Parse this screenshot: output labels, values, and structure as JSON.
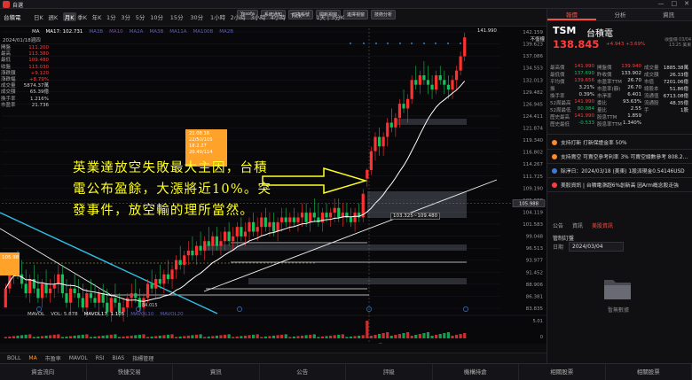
{
  "window": {
    "title": "自選",
    "controls": [
      "—",
      "□",
      "✕"
    ]
  },
  "toolbar": {
    "symbol": "台積電",
    "timeframes": [
      "日K",
      "週K",
      "月K",
      "季K",
      "年K",
      "1分",
      "3分",
      "5分",
      "10分",
      "15分",
      "30分",
      "1小時",
      "2小時",
      "3小時",
      "4小時",
      "Tick",
      "1天 | 3分K"
    ],
    "active_index": 2,
    "buttons": [
      "Yesofa",
      "系統通知",
      "切換帳號",
      "開新視窗",
      "進擇視窗",
      "技術分析"
    ]
  },
  "chart": {
    "stock_code": "2024/01/18",
    "ma_legend": [
      {
        "label": "MA",
        "color": "#dddddd"
      },
      {
        "label": "MA17: 102.731",
        "color": "#ffffff"
      },
      {
        "label": "MA3B",
        "color": "#5e5eb8"
      },
      {
        "label": "MA10",
        "color": "#7a4ea8"
      },
      {
        "label": "MA2A",
        "color": "#5e5eb8"
      },
      {
        "label": "MA3B",
        "color": "#5e5eb8"
      },
      {
        "label": "MA11A",
        "color": "#5e5eb8"
      },
      {
        "label": "MA100B",
        "color": "#5e5eb8"
      },
      {
        "label": "MA2B",
        "color": "#5e5eb8"
      }
    ],
    "date": "2024/01/18週四",
    "no_restore": "不復權",
    "info": [
      {
        "label": "開盤",
        "value": "111.200",
        "color": "#ff3b3b"
      },
      {
        "label": "最高",
        "value": "113.380",
        "color": "#ff3b3b"
      },
      {
        "label": "最低",
        "value": "109.480",
        "color": "#ff3b3b"
      },
      {
        "label": "收盤",
        "value": "113.030",
        "color": "#ff3b3b"
      },
      {
        "label": "漲跌額",
        "value": "+9.120",
        "color": "#ff3b3b"
      },
      {
        "label": "漲跌幅",
        "value": "+8.79%",
        "color": "#ff3b3b"
      },
      {
        "label": "成交量",
        "value": "5874.37萬",
        "color": "#cccccc"
      },
      {
        "label": "成交額",
        "value": "65.39億",
        "color": "#cccccc"
      },
      {
        "label": "換手率",
        "value": "1.216%",
        "color": "#cccccc"
      },
      {
        "label": "市盈率",
        "value": "21.736",
        "color": "#cccccc"
      }
    ],
    "annotation": "英業達放空失敗最大主因，台積電公布盈餘，大漲將近10%。突發事件，放空輸的理所當然。",
    "tooltip": [
      "21.08.16",
      "22/50/105",
      "18.2.27",
      "20.49/114"
    ],
    "range_label": "103.325~109.480",
    "left_tag": "105.98",
    "low_label": "84.015",
    "price_axis": [
      "142.159",
      "139.623",
      "137.086",
      "134.553",
      "132.013",
      "129.482",
      "126.945",
      "124.411",
      "121.874",
      "119.340",
      "116.802",
      "114.267",
      "111.725",
      "109.190",
      "105.988",
      "104.119",
      "101.583",
      "99.048",
      "96.513",
      "93.977",
      "91.452",
      "88.906",
      "86.381",
      "83.835"
    ],
    "price_current": "105.988",
    "high_mark": "141.990",
    "x_axis": [
      "2023/08",
      "9",
      "10",
      "11",
      "12",
      "2024/01/18週四",
      "2",
      "3"
    ],
    "vol_legend": [
      {
        "label": "MAVOL",
        "color": "#cccccc"
      },
      {
        "label": "VOL: 5.878",
        "color": "#cccccc"
      },
      {
        "label": "MAVOL17: 1.105",
        "color": "#ffffff"
      },
      {
        "label": "MAVOL10",
        "color": "#5e5eb8"
      },
      {
        "label": "MAVOL20",
        "color": "#5e5eb8"
      }
    ],
    "vol_axis": [
      "5.01",
      "0"
    ],
    "candles": [
      [
        84,
        89,
        84,
        88
      ],
      [
        88,
        92,
        87,
        91
      ],
      [
        91,
        95,
        89,
        93
      ],
      [
        93,
        96,
        90,
        91
      ],
      [
        91,
        94,
        88,
        89
      ],
      [
        89,
        92,
        86,
        87
      ],
      [
        87,
        91,
        85,
        90
      ],
      [
        90,
        93,
        87,
        88
      ],
      [
        88,
        91,
        85,
        86
      ],
      [
        86,
        90,
        84,
        89
      ],
      [
        89,
        92,
        86,
        87
      ],
      [
        87,
        90,
        85,
        88
      ],
      [
        88,
        91,
        86,
        89
      ],
      [
        89,
        93,
        87,
        91
      ],
      [
        91,
        93,
        86,
        87
      ],
      [
        87,
        90,
        84,
        85
      ],
      [
        85,
        89,
        83,
        88
      ],
      [
        88,
        91,
        86,
        87
      ],
      [
        87,
        90,
        84,
        86
      ],
      [
        86,
        89,
        83,
        84
      ],
      [
        84,
        88,
        82,
        87
      ],
      [
        87,
        90,
        85,
        86
      ],
      [
        86,
        89,
        84,
        85
      ],
      [
        85,
        88,
        83,
        87
      ],
      [
        87,
        89,
        84,
        85
      ],
      [
        85,
        88,
        82,
        83
      ],
      [
        83,
        87,
        81,
        86
      ],
      [
        86,
        89,
        84,
        85
      ],
      [
        85,
        87,
        82,
        83
      ],
      [
        83,
        86,
        81,
        84
      ],
      [
        84,
        87,
        82,
        86
      ],
      [
        86,
        89,
        84,
        87
      ],
      [
        87,
        90,
        85,
        86
      ],
      [
        86,
        88,
        83,
        84
      ],
      [
        84,
        87,
        82,
        86
      ],
      [
        86,
        90,
        85,
        89
      ],
      [
        89,
        92,
        87,
        88
      ],
      [
        88,
        91,
        86,
        90
      ],
      [
        90,
        93,
        88,
        89
      ],
      [
        89,
        92,
        87,
        91
      ],
      [
        91,
        94,
        89,
        90
      ],
      [
        90,
        93,
        88,
        92
      ],
      [
        92,
        95,
        90,
        94
      ],
      [
        94,
        97,
        92,
        93
      ],
      [
        93,
        96,
        91,
        95
      ],
      [
        95,
        98,
        93,
        96
      ],
      [
        96,
        99,
        94,
        95
      ],
      [
        95,
        98,
        93,
        97
      ],
      [
        97,
        100,
        95,
        96
      ],
      [
        96,
        99,
        94,
        98
      ],
      [
        98,
        101,
        96,
        97
      ],
      [
        97,
        100,
        95,
        99
      ],
      [
        99,
        101,
        96,
        97
      ],
      [
        97,
        100,
        95,
        98
      ],
      [
        98,
        101,
        96,
        100
      ],
      [
        100,
        102,
        97,
        98
      ],
      [
        98,
        101,
        96,
        99
      ],
      [
        99,
        102,
        97,
        101
      ],
      [
        101,
        103,
        98,
        99
      ],
      [
        99,
        102,
        97,
        100
      ],
      [
        100,
        103,
        98,
        102
      ],
      [
        102,
        104,
        99,
        100
      ],
      [
        100,
        103,
        98,
        101
      ],
      [
        101,
        104,
        99,
        103
      ],
      [
        103,
        105,
        100,
        101
      ],
      [
        101,
        104,
        99,
        102
      ],
      [
        102,
        104,
        99,
        100
      ],
      [
        100,
        103,
        98,
        102
      ],
      [
        102,
        105,
        100,
        103
      ],
      [
        103,
        105,
        101,
        102
      ],
      [
        102,
        104,
        100,
        103
      ],
      [
        103,
        105,
        101,
        102
      ],
      [
        102,
        104,
        100,
        103
      ],
      [
        103,
        106,
        101,
        104
      ],
      [
        104,
        106,
        101,
        102
      ],
      [
        102,
        105,
        100,
        104
      ],
      [
        104,
        107,
        102,
        103
      ],
      [
        103,
        106,
        101,
        102
      ],
      [
        102,
        105,
        100,
        104
      ],
      [
        104,
        106,
        102,
        103
      ],
      [
        103,
        105,
        101,
        104
      ],
      [
        104,
        107,
        102,
        105
      ],
      [
        105,
        107,
        102,
        103
      ],
      [
        103,
        106,
        101,
        104
      ],
      [
        104,
        106,
        102,
        103
      ],
      [
        103,
        105,
        101,
        102
      ],
      [
        102,
        105,
        100,
        104
      ],
      [
        104,
        106,
        102,
        103
      ],
      [
        103,
        109,
        102,
        108
      ],
      [
        111.2,
        113.38,
        109.48,
        113.03
      ],
      [
        113,
        118,
        112,
        117
      ],
      [
        117,
        121,
        115,
        120
      ],
      [
        120,
        122,
        116,
        118
      ],
      [
        118,
        121,
        116,
        120
      ],
      [
        120,
        124,
        118,
        123
      ],
      [
        123,
        126,
        121,
        122
      ],
      [
        122,
        125,
        120,
        124
      ],
      [
        124,
        128,
        122,
        127
      ],
      [
        127,
        130,
        125,
        126
      ],
      [
        126,
        129,
        123,
        128
      ],
      [
        128,
        133,
        127,
        132
      ],
      [
        132,
        135,
        130,
        131
      ],
      [
        131,
        134,
        129,
        133
      ],
      [
        133,
        136,
        131,
        132
      ],
      [
        132,
        135,
        129,
        131
      ],
      [
        131,
        133,
        128,
        130
      ],
      [
        130,
        134,
        129,
        133
      ],
      [
        133,
        135,
        131,
        132
      ],
      [
        132,
        134,
        129,
        131
      ],
      [
        131,
        133,
        128,
        130
      ],
      [
        130,
        133,
        128,
        132
      ],
      [
        132,
        135,
        130,
        134
      ],
      [
        134,
        138,
        133,
        137
      ],
      [
        137,
        142,
        136,
        141
      ]
    ]
  },
  "bottom_tabs": [
    "BOLL",
    "MA",
    "市盈率",
    "MAVOL",
    "RSI",
    "BIAS",
    "指標管理"
  ],
  "bottom_active": 1,
  "bottom_right": [
    "時段",
    "設定"
  ],
  "footer_nav": [
    "資金流向",
    "快捷交易",
    "資訊",
    "公告",
    "評級",
    "機構持倉",
    "相關股票",
    "相關股票"
  ],
  "right_panel": {
    "tabs": [
      "報價",
      "分析",
      "資訊"
    ],
    "active_tab": 0,
    "ticker": "TSM",
    "company": "台積電",
    "price": "138.845",
    "change": "+4.943 +3.69%",
    "quote_time": "收盤價 03/04 13:25 美東",
    "stats": [
      [
        [
          "最高價",
          "141.990"
        ],
        [
          "開盤價",
          "139.940"
        ],
        [
          "成交量",
          "1885.38萬"
        ]
      ],
      [
        [
          "最低價",
          "137.690"
        ],
        [
          "昨收價",
          "133.902"
        ],
        [
          "成交額",
          "26.33億"
        ]
      ],
      [
        [
          "平均價",
          "139.656"
        ],
        [
          "市盈率TTM",
          "26.70"
        ],
        [
          "市值",
          "7201.06億"
        ]
      ],
      [
        [
          "振",
          "3.21%"
        ],
        [
          "市盈率(靜)",
          "26.70"
        ],
        [
          "總股本",
          "51.86億"
        ]
      ],
      [
        [
          "換手率",
          "0.39%"
        ],
        [
          "市淨率",
          "6.401"
        ],
        [
          "流通值",
          "6713.08億"
        ]
      ],
      [
        [
          "52周最高",
          "141.990"
        ],
        [
          "委比",
          "93.63%"
        ],
        [
          "流通股",
          "48.35億"
        ]
      ],
      [
        [
          "52周最低",
          "80.084"
        ],
        [
          "量比",
          "2.55"
        ],
        [
          "手",
          "1股"
        ]
      ],
      [
        [
          "歷史最高",
          "141.990"
        ],
        [
          "股息TTM",
          "1.859"
        ],
        [
          "",
          ""
        ]
      ],
      [
        [
          "歷史最低",
          "-0.533"
        ],
        [
          "股息率TTM",
          "1.340%"
        ],
        [
          "",
          ""
        ]
      ]
    ],
    "events": [
      {
        "text": "支持打新 打新保證金率 50%",
        "color": "#ff8a2a"
      },
      {
        "text": "支持賣空 可賣空參考利率 3% 可賣空總數參考 808.2萬股",
        "color": "#ff8a2a"
      },
      {
        "text": "除淨日：2024/03/18 (美東) 1股派現金0.54146USD",
        "color": "#3a7bd5"
      },
      {
        "text": "美股資訊 | 台積電漲超6%創新高 因Arm概念股走強",
        "color": "#ff3b3b"
      }
    ],
    "news_tabs": [
      "公告",
      "資訊",
      "美股資訊"
    ],
    "news_active": 2,
    "sub_head": "管制訂盤",
    "date_label": "日期",
    "date_value": "2024/03/04",
    "empty_text": "暫無數據"
  }
}
